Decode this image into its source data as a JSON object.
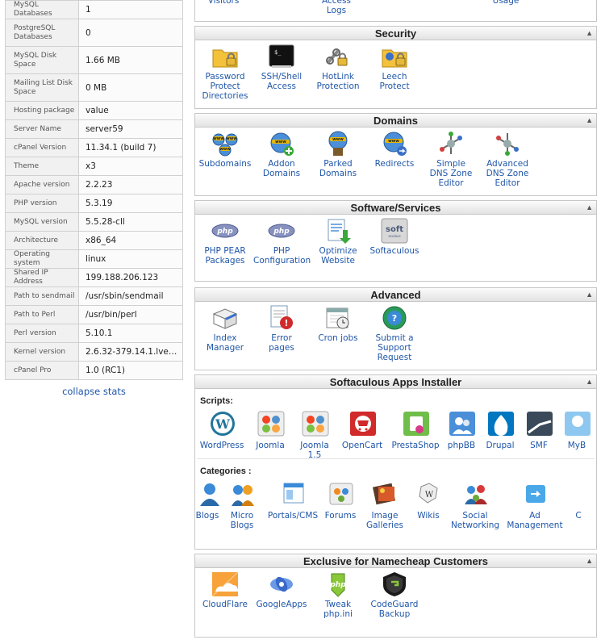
{
  "stats": {
    "rows": [
      {
        "key": "MySQL Databases",
        "value": "1"
      },
      {
        "key": "PostgreSQL Databases",
        "value": "0"
      },
      {
        "key": "MySQL Disk Space",
        "value": "1.66 MB"
      },
      {
        "key": "Mailing List Disk Space",
        "value": "0 MB"
      },
      {
        "key": "Hosting package",
        "value": "value"
      },
      {
        "key": "Server Name",
        "value": "server59"
      },
      {
        "key": "cPanel Version",
        "value": "11.34.1 (build 7)"
      },
      {
        "key": "Theme",
        "value": "x3"
      },
      {
        "key": "Apache version",
        "value": "2.2.23"
      },
      {
        "key": "PHP version",
        "value": "5.3.19"
      },
      {
        "key": "MySQL version",
        "value": "5.5.28-cll"
      },
      {
        "key": "Architecture",
        "value": "x86_64"
      },
      {
        "key": "Operating system",
        "value": "linux"
      },
      {
        "key": "Shared IP Address",
        "value": "199.188.206.123"
      },
      {
        "key": "Path to sendmail",
        "value": "/usr/sbin/sendmail"
      },
      {
        "key": "Path to Perl",
        "value": "/usr/bin/perl"
      },
      {
        "key": "Perl version",
        "value": "5.10.1"
      },
      {
        "key": "Kernel version",
        "value": "2.6.32-379.14.1.lve…"
      },
      {
        "key": "cPanel Pro",
        "value": "1.0 (RC1)"
      }
    ],
    "collapse_label": "collapse stats"
  },
  "top_partial": {
    "items": [
      {
        "label": "Visitors",
        "icon": "visitors-icon"
      },
      {
        "label": "Access\nLogs",
        "icon": "access-logs-icon"
      },
      {
        "label": "Usage",
        "icon": "bandwidth-usage-icon"
      }
    ]
  },
  "security": {
    "title": "Security",
    "toggle": "▲",
    "items": [
      {
        "label": "Password\nProtect\nDirectories",
        "icon": "folder-lock-icon"
      },
      {
        "label": "SSH/Shell\nAccess",
        "icon": "terminal-icon"
      },
      {
        "label": "HotLink\nProtection",
        "icon": "chain-lock-icon"
      },
      {
        "label": "Leech\nProtect",
        "icon": "leech-lock-icon"
      }
    ]
  },
  "domains": {
    "title": "Domains",
    "toggle": "▲",
    "items": [
      {
        "label": "Subdomains",
        "icon": "subdomains-icon"
      },
      {
        "label": "Addon\nDomains",
        "icon": "addon-domains-icon"
      },
      {
        "label": "Parked\nDomains",
        "icon": "parked-domains-icon"
      },
      {
        "label": "Redirects",
        "icon": "redirects-icon"
      },
      {
        "label": "Simple\nDNS Zone\nEditor",
        "icon": "dns-zone-icon"
      },
      {
        "label": "Advanced\nDNS Zone\nEditor",
        "icon": "advanced-dns-icon"
      }
    ]
  },
  "software": {
    "title": "Software/Services",
    "toggle": "▲",
    "items": [
      {
        "label": "PHP PEAR\nPackages",
        "icon": "php-pear-icon"
      },
      {
        "label": "PHP\nConfiguration",
        "icon": "php-config-icon"
      },
      {
        "label": "Optimize\nWebsite",
        "icon": "optimize-website-icon"
      },
      {
        "label": "Softaculous",
        "icon": "softaculous-icon"
      }
    ]
  },
  "advanced": {
    "title": "Advanced",
    "toggle": "▲",
    "items": [
      {
        "label": "Index\nManager",
        "icon": "index-manager-icon"
      },
      {
        "label": "Error\npages",
        "icon": "error-pages-icon"
      },
      {
        "label": "Cron jobs",
        "icon": "cron-jobs-icon"
      },
      {
        "label": "Submit a\nSupport\nRequest",
        "icon": "support-request-icon"
      }
    ]
  },
  "softaculous": {
    "title": "Softaculous Apps Installer",
    "toggle": "▲",
    "scripts_label": "Scripts:",
    "scripts": [
      {
        "label": "WordPress",
        "icon": "wordpress-icon"
      },
      {
        "label": "Joomla",
        "icon": "joomla-icon"
      },
      {
        "label": "Joomla\n1.5",
        "icon": "joomla15-icon"
      },
      {
        "label": "OpenCart",
        "icon": "opencart-icon"
      },
      {
        "label": "PrestaShop",
        "icon": "prestashop-icon"
      },
      {
        "label": "phpBB",
        "icon": "phpbb-icon"
      },
      {
        "label": "Drupal",
        "icon": "drupal-icon"
      },
      {
        "label": "SMF",
        "icon": "smf-icon"
      },
      {
        "label": "MyB",
        "icon": "mybb-icon"
      }
    ],
    "categories_label": "Categories :",
    "categories": [
      {
        "label": "Blogs",
        "icon": "blogs-icon"
      },
      {
        "label": "Micro\nBlogs",
        "icon": "micro-blogs-icon"
      },
      {
        "label": "Portals/CMS",
        "icon": "portals-cms-icon"
      },
      {
        "label": "Forums",
        "icon": "forums-icon"
      },
      {
        "label": "Image\nGalleries",
        "icon": "image-galleries-icon"
      },
      {
        "label": "Wikis",
        "icon": "wikis-icon"
      },
      {
        "label": "Social\nNetworking",
        "icon": "social-networking-icon"
      },
      {
        "label": "Ad\nManagement",
        "icon": "ad-management-icon"
      },
      {
        "label": "C",
        "icon": "more-category-icon"
      }
    ]
  },
  "namecheap": {
    "title": "Exclusive for Namecheap Customers",
    "toggle": "▲",
    "items": [
      {
        "label": "CloudFlare",
        "icon": "cloudflare-icon"
      },
      {
        "label": "GoogleApps",
        "icon": "googleapps-icon"
      },
      {
        "label": "Tweak\nphp.ini",
        "icon": "tweak-phpini-icon"
      },
      {
        "label": "CodeGuard\nBackup",
        "icon": "codeguard-icon"
      }
    ]
  }
}
